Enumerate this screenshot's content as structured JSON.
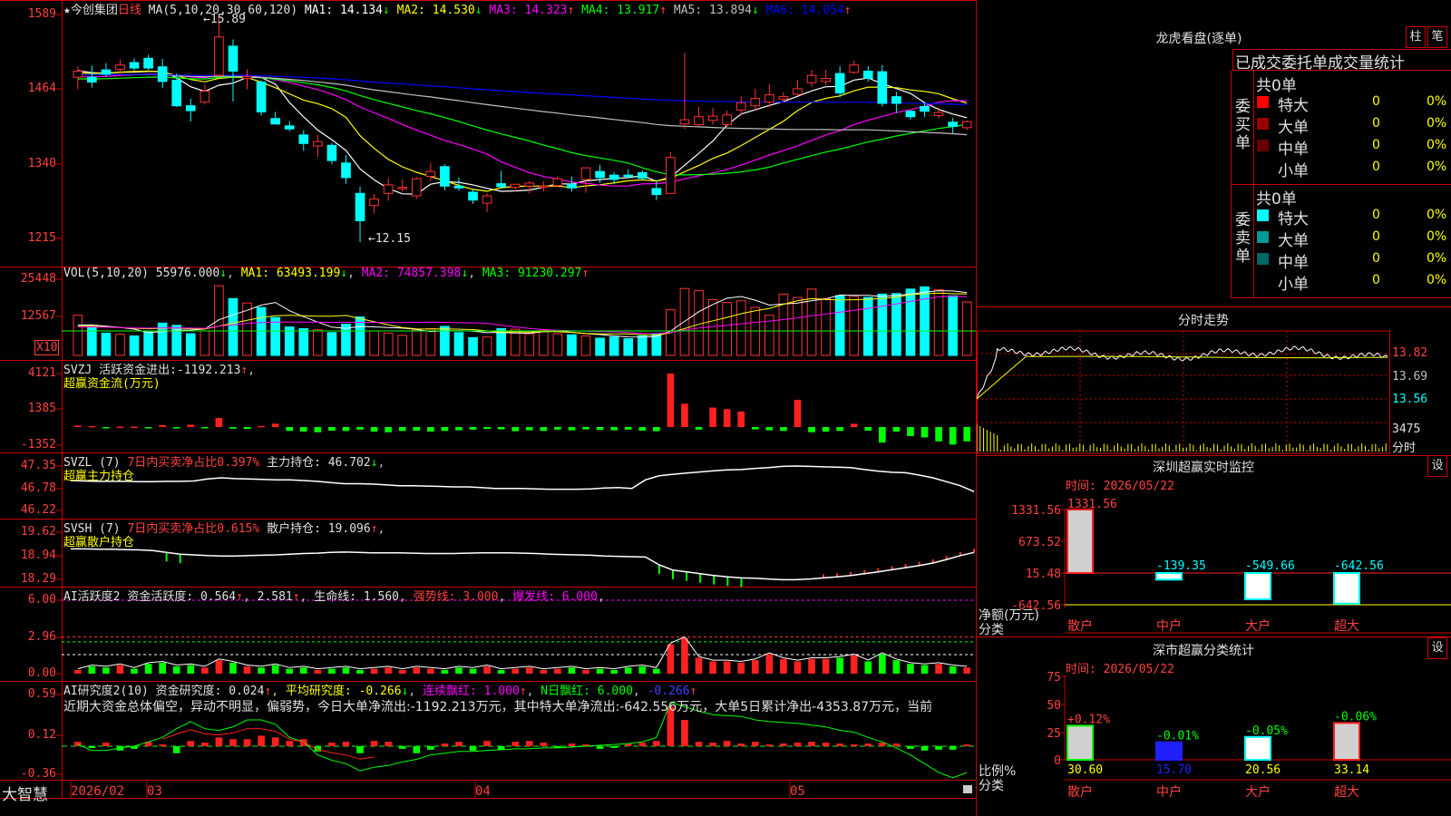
{
  "main": {
    "stock_title": "★今创集团",
    "period": "日线",
    "ma_params": "MA(5,10,20,30,60,120)",
    "ma": [
      {
        "label": "MA1:",
        "value": "14.134",
        "arrow": "↓",
        "color": "#ffffff"
      },
      {
        "label": "MA2:",
        "value": "14.530",
        "arrow": "↓",
        "color": "#ffff00"
      },
      {
        "label": "MA3:",
        "value": "14.323",
        "arrow": "↑",
        "color": "#ff00ff"
      },
      {
        "label": "MA4:",
        "value": "13.917",
        "arrow": "↑",
        "color": "#00ff00"
      },
      {
        "label": "MA5:",
        "value": "13.894",
        "arrow": "↓",
        "color": "#c0c0c0"
      },
      {
        "label": "MA6:",
        "value": "14.054",
        "arrow": "↑",
        "color": "#0000ff"
      }
    ],
    "high_mark": "15.89",
    "low_mark": "←12.15",
    "yticks": [
      "1589",
      "1464",
      "1340",
      "1215"
    ]
  },
  "vol": {
    "header_label": "VOL(5,10,20)",
    "value": "55976.000",
    "ma1": "63493.199",
    "ma2": "74857.398",
    "ma3": "91230.297",
    "yticks": [
      "25448",
      "12567"
    ],
    "x10": "X10"
  },
  "svzj": {
    "name": "SVZJ",
    "desc": "活跃资金进出:",
    "value": "-1192.213",
    "sub": "超赢资金流(万元)",
    "yticks": [
      "4121",
      "1385",
      "-1352"
    ]
  },
  "svzl": {
    "name": "SVZL (7)",
    "desc": "7日内买卖净占比0.397%",
    "hold_label": "主力持仓:",
    "hold": "46.702",
    "sub": "超赢主力持仓",
    "yticks": [
      "47.35",
      "46.78",
      "46.22"
    ]
  },
  "svsh": {
    "name": "SVSH (7)",
    "desc": "7日内买卖净占比0.615%",
    "hold_label": "散户持仓:",
    "hold": "19.096",
    "sub": "超赢散户持仓",
    "yticks": [
      "19.62",
      "18.94",
      "18.29"
    ]
  },
  "ai1": {
    "name": "AI活跃度2",
    "lbl": "资金活跃度:",
    "v1": "0.564",
    "v2": "2.581",
    "life_label": "生命线:",
    "life": "1.560",
    "strong": "强势线: 3.000",
    "burst": "爆发线: 6.000",
    "yticks": [
      "6.00",
      "2.96",
      "0.00"
    ]
  },
  "ai2": {
    "name": "AI研究度2(10)",
    "lbl": "资金研究度:",
    "v": "0.024",
    "avg_label": "平均研究度:",
    "avg": "-0.266",
    "red_label": "连续飘红:",
    "red": "1.000",
    "nred_label": "N日飘红:",
    "nred": "6.000",
    "nred2": "-0.266",
    "comment": "近期大资金总体偏空，异动不明显，偏弱势，今日大单净流出:-1192.213万元，其中特大单净流出:-642.556万元，大单5日累计净出-4353.87万元，当前",
    "yticks": [
      "0.59",
      "0.12",
      "-0.36"
    ]
  },
  "xaxis": {
    "app": "大智慧",
    "labels": [
      "2026/02",
      "03",
      "04",
      "05"
    ]
  },
  "right": {
    "lhb_title": "龙虎看盘(逐单)",
    "btn_zhu": "柱",
    "btn_bi": "笔",
    "tabs": "已成交委托单成交量统计",
    "buy_label": "委买单",
    "sell_label": "委卖单",
    "buy_total": "共0单",
    "sell_total": "共0单",
    "buy_rows": [
      {
        "name": "特大",
        "count": "0",
        "pct": "0%",
        "color": "#ff0000"
      },
      {
        "name": "大单",
        "count": "0",
        "pct": "0%",
        "color": "#990000"
      },
      {
        "name": "中单",
        "count": "0",
        "pct": "0%",
        "color": "#660000"
      },
      {
        "name": "小单",
        "count": "0",
        "pct": "0%",
        "color": ""
      }
    ],
    "sell_rows": [
      {
        "name": "特大",
        "count": "0",
        "pct": "0%",
        "color": "#00ffff"
      },
      {
        "name": "大单",
        "count": "0",
        "pct": "0%",
        "color": "#009999"
      },
      {
        "name": "中单",
        "count": "0",
        "pct": "0%",
        "color": "#006666"
      },
      {
        "name": "小单",
        "count": "0",
        "pct": "0%",
        "color": ""
      }
    ],
    "ts_title": "分时走势",
    "ts_ylabels": [
      "13.82",
      "13.69",
      "13.56",
      "3475"
    ],
    "ts_time": "分时",
    "sz_title": "深圳超赢实时监控",
    "set": "设",
    "sz_time": "时间: 2026/05/22",
    "sz_yticks": [
      "1331.56",
      "673.52",
      "15.48",
      "-642.56"
    ],
    "sz_unit": "净额(万元)",
    "sz_cat": "分类",
    "sz_bars": [
      {
        "label": "散户",
        "value": "1331.56"
      },
      {
        "label": "中户",
        "value": "-139.35"
      },
      {
        "label": "大户",
        "value": "-549.66"
      },
      {
        "label": "超大",
        "value": "-642.56"
      }
    ],
    "st_title": "深市超赢分类统计",
    "st_time": "时间: 2026/05/22",
    "st_yticks": [
      "75",
      "50",
      "25",
      "0"
    ],
    "st_unit": "比例%",
    "st_cat": "分类",
    "st_bars": [
      {
        "label": "散户",
        "value": "30.60",
        "delta": "+0.12%"
      },
      {
        "label": "中户",
        "value": "15.70",
        "delta": "-0.01%"
      },
      {
        "label": "大户",
        "value": "20.56",
        "delta": "-0.05%"
      },
      {
        "label": "超大",
        "value": "33.14",
        "delta": "-0.06%"
      }
    ]
  },
  "chart_data": {
    "type": "candlestick",
    "candles": [
      [
        14.86,
        15.04,
        14.66,
        14.96
      ],
      [
        14.86,
        15.05,
        14.69,
        14.78
      ],
      [
        14.98,
        15.09,
        14.86,
        14.91
      ],
      [
        14.99,
        15.15,
        14.91,
        15.06
      ],
      [
        15.1,
        15.17,
        14.97,
        15.01
      ],
      [
        15.17,
        15.23,
        14.98,
        15.01
      ],
      [
        15.03,
        15.16,
        14.68,
        14.79
      ],
      [
        14.81,
        14.92,
        14.37,
        14.39
      ],
      [
        14.39,
        14.51,
        14.13,
        14.31
      ],
      [
        14.45,
        14.74,
        14.41,
        14.63
      ],
      [
        14.89,
        15.89,
        14.88,
        15.52
      ],
      [
        15.37,
        15.48,
        14.46,
        14.96
      ],
      [
        14.84,
        14.99,
        14.66,
        14.87
      ],
      [
        14.78,
        14.81,
        14.23,
        14.29
      ],
      [
        14.18,
        14.29,
        14.09,
        14.09
      ],
      [
        14.06,
        14.14,
        13.97,
        14.01
      ],
      [
        13.91,
        13.99,
        13.65,
        13.77
      ],
      [
        13.73,
        13.91,
        13.55,
        13.8
      ],
      [
        13.74,
        13.78,
        13.43,
        13.49
      ],
      [
        13.45,
        13.58,
        13.11,
        13.21
      ],
      [
        12.95,
        13.06,
        12.15,
        12.5
      ],
      [
        12.75,
        12.94,
        12.62,
        12.86
      ],
      [
        12.95,
        13.2,
        12.83,
        13.09
      ],
      [
        13.04,
        13.18,
        12.98,
        13.05
      ],
      [
        12.91,
        13.22,
        12.86,
        13.19
      ],
      [
        13.23,
        13.45,
        13.15,
        13.31
      ],
      [
        13.39,
        13.43,
        13.0,
        13.07
      ],
      [
        13.07,
        13.21,
        12.99,
        13.04
      ],
      [
        12.97,
        13.02,
        12.78,
        12.84
      ],
      [
        12.79,
        12.95,
        12.64,
        12.91
      ],
      [
        13.11,
        13.32,
        13.05,
        13.06
      ],
      [
        13.05,
        13.11,
        12.98,
        13.1
      ],
      [
        13.07,
        13.15,
        12.95,
        13.12
      ],
      [
        13.06,
        13.15,
        12.98,
        13.07
      ],
      [
        13.08,
        13.23,
        13.05,
        13.19
      ],
      [
        13.1,
        13.23,
        12.98,
        13.04
      ],
      [
        13.18,
        13.36,
        12.96,
        13.37
      ],
      [
        13.31,
        13.42,
        13.12,
        13.21
      ],
      [
        13.25,
        13.3,
        13.1,
        13.18
      ],
      [
        13.25,
        13.34,
        13.2,
        13.24
      ],
      [
        13.29,
        13.33,
        13.17,
        13.2
      ],
      [
        13.03,
        13.15,
        12.84,
        12.93
      ],
      [
        12.95,
        13.63,
        12.95,
        13.54
      ],
      [
        14.09,
        15.26,
        14.01,
        14.16
      ],
      [
        14.08,
        14.37,
        14.05,
        14.21
      ],
      [
        14.15,
        14.36,
        14.08,
        14.22
      ],
      [
        14.08,
        14.31,
        14.04,
        14.24
      ],
      [
        14.32,
        14.55,
        14.23,
        14.44
      ],
      [
        14.39,
        14.67,
        14.31,
        14.51
      ],
      [
        14.45,
        14.75,
        14.36,
        14.57
      ],
      [
        14.5,
        14.61,
        14.48,
        14.54
      ],
      [
        14.58,
        14.81,
        14.55,
        14.67
      ],
      [
        14.77,
        14.98,
        14.7,
        14.89
      ],
      [
        14.79,
        14.98,
        14.73,
        14.84
      ],
      [
        14.92,
        15.04,
        14.53,
        14.6
      ],
      [
        14.94,
        15.13,
        14.91,
        15.06
      ],
      [
        14.96,
        15.04,
        14.79,
        14.84
      ],
      [
        14.95,
        15.06,
        14.38,
        14.43
      ],
      [
        14.54,
        14.62,
        14.27,
        14.43
      ],
      [
        14.3,
        14.32,
        14.16,
        14.21
      ],
      [
        14.38,
        14.45,
        14.21,
        14.3
      ],
      [
        14.23,
        14.36,
        14.18,
        14.28
      ],
      [
        14.12,
        14.19,
        13.94,
        14.05
      ],
      [
        14.03,
        14.15,
        13.99,
        14.13
      ]
    ],
    "ma_series": [
      "MA1",
      "MA2",
      "MA3",
      "MA4",
      "MA5",
      "MA6"
    ],
    "ylim": [
      12.0,
      16.0
    ],
    "volume_x10": [
      7.2,
      5.1,
      4.0,
      3.8,
      3.5,
      4.2,
      5.8,
      5.4,
      3.9,
      4.4,
      12.5,
      10.2,
      9.4,
      8.6,
      6.8,
      5.1,
      4.8,
      4.6,
      4.1,
      5.6,
      6.9,
      4.4,
      4.0,
      3.6,
      4.5,
      4.8,
      5.2,
      4.1,
      3.2,
      3.3,
      4.8,
      4.7,
      3.9,
      4.5,
      3.9,
      3.7,
      3.5,
      3.1,
      3.3,
      3.0,
      3.5,
      3.9,
      8.2,
      12.0,
      11.6,
      10.0,
      9.5,
      9.8,
      8.6,
      7.2,
      11.0,
      10.4,
      11.9,
      10.2,
      10.7,
      10.6,
      10.4,
      11.0,
      11.1,
      11.9,
      12.3,
      11.8,
      10.7,
      9.6
    ],
    "svzj": [
      120,
      80,
      -60,
      40,
      30,
      -50,
      150,
      -80,
      180,
      -40,
      700,
      -120,
      -150,
      80,
      260,
      -300,
      -350,
      -400,
      -280,
      -300,
      -200,
      -350,
      -400,
      -300,
      -280,
      -350,
      -300,
      -250,
      -200,
      -150,
      -180,
      -320,
      -250,
      -300,
      -200,
      -250,
      -180,
      -220,
      -250,
      -200,
      -280,
      -320,
      4121,
      1800,
      -200,
      1500,
      1380,
      1200,
      -180,
      -250,
      -300,
      2100,
      -400,
      -350,
      -300,
      250,
      -280,
      -1200,
      -350,
      -700,
      -800,
      -1100,
      -1352,
      -1100
    ],
    "svzl": [
      46.98,
      46.97,
      46.96,
      46.96,
      46.96,
      46.95,
      46.95,
      46.96,
      46.96,
      46.97,
      47.02,
      47.05,
      47.03,
      47.02,
      47.01,
      47.0,
      47.0,
      46.98,
      46.96,
      46.93,
      46.9,
      46.9,
      46.89,
      46.87,
      46.85,
      46.85,
      46.84,
      46.83,
      46.82,
      46.82,
      46.8,
      46.78,
      46.78,
      46.78,
      46.77,
      46.76,
      46.76,
      46.76,
      46.77,
      46.79,
      46.8,
      46.78,
      47.0,
      47.1,
      47.14,
      47.17,
      47.2,
      47.23,
      47.25,
      47.26,
      47.29,
      47.31,
      47.34,
      47.35,
      47.34,
      47.33,
      47.32,
      47.31,
      47.26,
      47.22,
      47.19,
      47.18,
      47.12,
      47.05,
      46.95,
      46.85,
      46.7
    ],
    "svsh": [
      19.15,
      19.15,
      19.14,
      19.14,
      19.13,
      19.12,
      19.1,
      19.05,
      19.0,
      18.98,
      18.96,
      18.95,
      18.95,
      18.96,
      18.97,
      18.98,
      19.0,
      19.02,
      19.03,
      19.05,
      19.06,
      19.05,
      19.04,
      19.04,
      19.04,
      19.03,
      19.02,
      19.02,
      19.02,
      19.03,
      19.04,
      19.04,
      19.04,
      19.03,
      19.02,
      19.0,
      18.99,
      18.98,
      18.97,
      18.95,
      18.94,
      18.93,
      18.92,
      18.7,
      18.55,
      18.5,
      18.45,
      18.4,
      18.36,
      18.33,
      18.32,
      18.3,
      18.28,
      18.28,
      18.3,
      18.33,
      18.36,
      18.4,
      18.45,
      18.5,
      18.56,
      18.62,
      18.68,
      18.75,
      18.85,
      18.96,
      19.05
    ],
    "ai1": [
      0.3,
      0.6,
      0.5,
      0.7,
      0.4,
      0.8,
      0.9,
      0.6,
      0.7,
      0.5,
      1.1,
      0.9,
      0.6,
      0.5,
      0.7,
      0.4,
      0.5,
      0.3,
      0.4,
      0.5,
      0.3,
      0.4,
      0.5,
      0.3,
      0.5,
      0.4,
      0.3,
      0.5,
      0.4,
      0.6,
      0.3,
      0.4,
      0.5,
      0.3,
      0.4,
      0.5,
      0.3,
      0.4,
      0.3,
      0.5,
      0.6,
      0.4,
      2.4,
      2.9,
      1.3,
      1.0,
      1.0,
      0.9,
      1.1,
      1.6,
      1.2,
      1.0,
      1.2,
      1.2,
      1.3,
      1.5,
      1.0,
      1.6,
      1.1,
      0.8,
      0.7,
      0.8,
      0.6,
      0.5
    ],
    "ai2": [
      0.05,
      -0.02,
      0.04,
      -0.05,
      -0.03,
      0.05,
      0.02,
      -0.08,
      0.06,
      0.04,
      0.1,
      0.08,
      0.08,
      0.12,
      0.1,
      0.06,
      0.08,
      -0.06,
      0.04,
      0.05,
      -0.08,
      0.06,
      0.05,
      -0.03,
      -0.08,
      -0.04,
      0.03,
      0.05,
      -0.05,
      0.06,
      -0.04,
      0.05,
      0.06,
      0.04,
      -0.02,
      0.03,
      0.02,
      -0.03,
      -0.02,
      0.03,
      0.04,
      0.06,
      0.45,
      0.3,
      0.05,
      0.04,
      0.06,
      0.03,
      0.05,
      0.02,
      0.03,
      0.04,
      0.05,
      0.04,
      0.03,
      0.02,
      0.03,
      0.04,
      0.03,
      -0.03,
      -0.05,
      -0.04,
      -0.04,
      0.02
    ]
  }
}
